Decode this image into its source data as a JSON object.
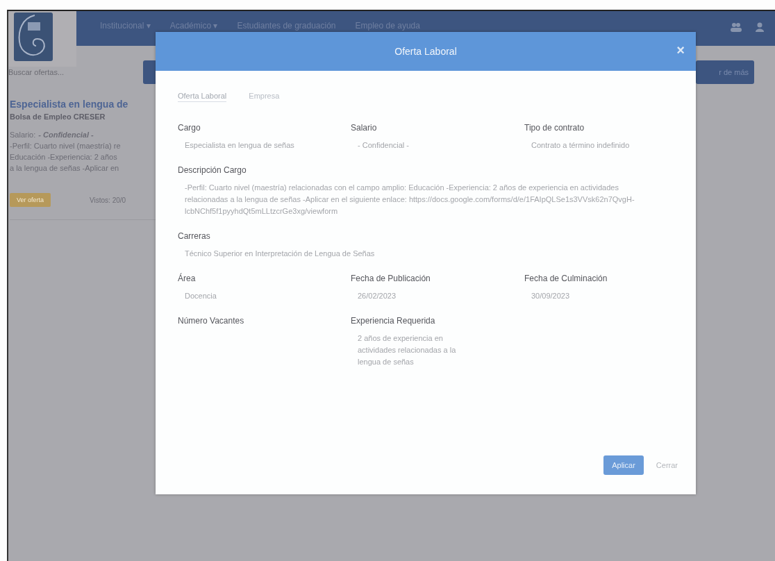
{
  "navbar": {
    "items": [
      {
        "label": "Institucional ▾"
      },
      {
        "label": "Académico ▾"
      },
      {
        "label": "Estudiantes de graduación"
      },
      {
        "label": "Empleo de ayuda"
      }
    ]
  },
  "search": {
    "placeholder": "Buscar ofertas..."
  },
  "right_button": {
    "label": "r de más"
  },
  "offer_card": {
    "title": "Especialista en lengua de",
    "company": "Bolsa de Empleo CRESER",
    "salary_label": "Salario:",
    "salary": "- Confidencial -",
    "description_lines": [
      "-Perfil: Cuarto nivel (maestría) re",
      "Educación -Experiencia: 2 años",
      "a la lengua de señas -Aplicar en"
    ],
    "badge": "Ver oferta",
    "visits": "Vistos: 20/0"
  },
  "modal": {
    "title": "Oferta Laboral",
    "close": "×",
    "tabs": [
      {
        "label": "Oferta Laboral",
        "selected": true
      },
      {
        "label": "Empresa",
        "selected": false
      }
    ],
    "rows": [
      {
        "fields": [
          {
            "label": "Cargo",
            "value": "Especialista en lengua de señas"
          },
          {
            "label": "Salario",
            "value": "- Confidencial -"
          },
          {
            "label": "Tipo de contrato",
            "value": "Contrato a término indefinido"
          }
        ]
      },
      {
        "fields": [
          {
            "label": "Descripción Cargo",
            "value": "-Perfil: Cuarto nivel (maestría) relacionadas con el campo amplio: Educación -Experiencia: 2 años de experiencia en actividades relacionadas a la lengua de señas -Aplicar en el siguiente enlace: https://docs.google.com/forms/d/e/1FAIpQLSe1s3VVsk62n7QvgH-lcbNChf5f1pyyhdQt5mLLtzcrGe3xg/viewform"
          }
        ]
      },
      {
        "fields": [
          {
            "label": "Carreras",
            "value": "Técnico Superior en Interpretación de Lengua de Señas"
          }
        ]
      },
      {
        "fields": [
          {
            "label": "Área",
            "value": "Docencia"
          },
          {
            "label": "Fecha de Publicación",
            "value": "26/02/2023"
          },
          {
            "label": "Fecha de Culminación",
            "value": "30/09/2023"
          }
        ]
      },
      {
        "fields": [
          {
            "label": "Número Vacantes"
          },
          {
            "label": "Experiencia Requerida",
            "value": "2 años de experiencia en actividades relacionadas a la lengua de señas"
          }
        ]
      }
    ],
    "buttons": [
      {
        "label": "Aplicar",
        "kind": "primary"
      },
      {
        "label": "Cerrar",
        "kind": "link"
      }
    ]
  }
}
